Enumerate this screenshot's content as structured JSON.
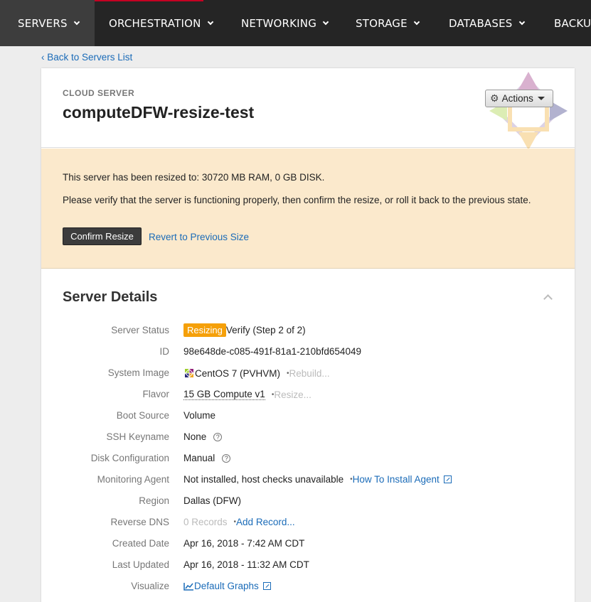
{
  "nav": {
    "items": [
      {
        "label": "SERVERS",
        "active": true
      },
      {
        "label": "ORCHESTRATION"
      },
      {
        "label": "NETWORKING"
      },
      {
        "label": "STORAGE"
      },
      {
        "label": "DATABASES"
      },
      {
        "label": "BACKUP"
      }
    ],
    "accent_color": "#c40022"
  },
  "back_link": "‹ Back to Servers List",
  "header": {
    "eyebrow": "CLOUD SERVER",
    "server_name": "computeDFW-resize-test",
    "actions_label": "Actions"
  },
  "alert": {
    "line1": "This server has been resized to: 30720 MB RAM, 0 GB DISK.",
    "line2": "Please verify that the server is functioning properly, then confirm the resize, or roll it back to the previous state.",
    "confirm_label": "Confirm Resize",
    "revert_label": "Revert to Previous Size",
    "background": "#fbe9cc"
  },
  "details": {
    "title": "Server Details",
    "status": {
      "label": "Server Status",
      "badge": "Resizing",
      "text": "Verify (Step 2 of 2)",
      "badge_color": "#f5a00a"
    },
    "id": {
      "label": "ID",
      "value": "98e648de-c085-491f-81a1-210bfd654049"
    },
    "image": {
      "label": "System Image",
      "value": "CentOS 7 (PVHVM)",
      "action": "Rebuild..."
    },
    "flavor": {
      "label": "Flavor",
      "value": "15 GB Compute v1",
      "action": "Resize..."
    },
    "boot": {
      "label": "Boot Source",
      "value": "Volume"
    },
    "ssh": {
      "label": "SSH Keyname",
      "value": "None"
    },
    "disk": {
      "label": "Disk Configuration",
      "value": "Manual"
    },
    "monitoring": {
      "label": "Monitoring Agent",
      "value": "Not installed, host checks unavailable",
      "link": "How To Install Agent"
    },
    "region": {
      "label": "Region",
      "value": "Dallas (DFW)"
    },
    "rdns": {
      "label": "Reverse DNS",
      "value": "0 Records",
      "link": "Add Record..."
    },
    "created": {
      "label": "Created Date",
      "value": "Apr 16, 2018 - 7:42 AM CDT"
    },
    "updated": {
      "label": "Last Updated",
      "value": "Apr 16, 2018 - 11:32 AM CDT"
    },
    "visualize": {
      "label": "Visualize",
      "link": "Default Graphs"
    }
  }
}
